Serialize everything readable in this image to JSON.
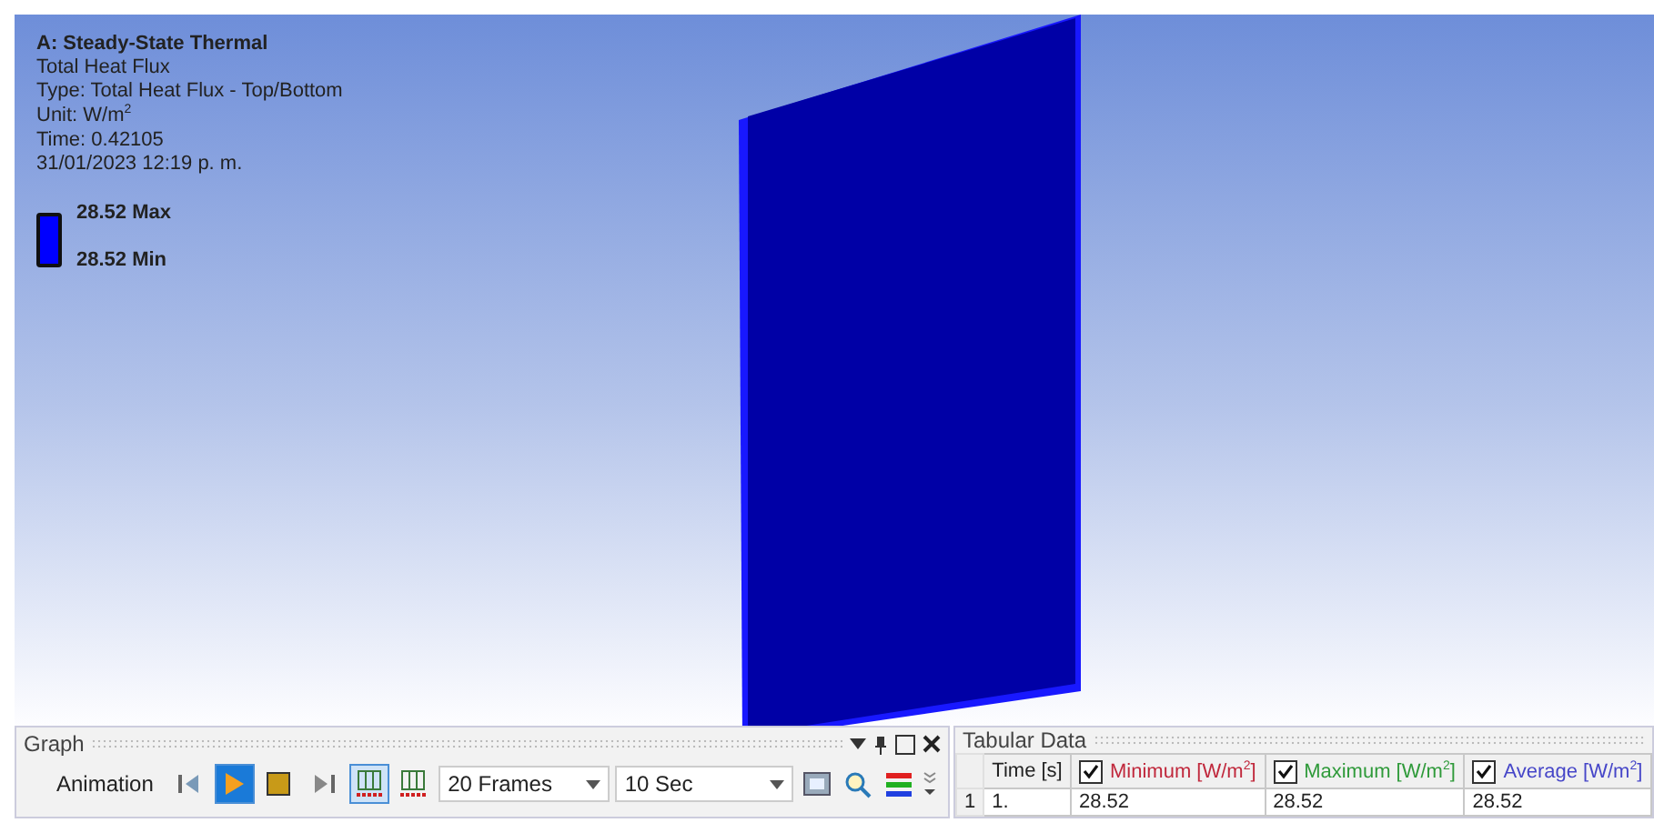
{
  "viewport": {
    "annotation": {
      "title": "A: Steady-State Thermal",
      "lines": [
        "Total Heat Flux",
        "Type: Total Heat Flux - Top/Bottom",
        "Unit: W/m$^{2}$",
        "Time: 0.42105",
        "31/01/2023 12:19 p. m."
      ]
    },
    "legend": {
      "max": "28.52 Max",
      "min": "28.52 Min"
    }
  },
  "graph_panel": {
    "title": "Graph",
    "toolbar": {
      "label": "Animation",
      "controls": [
        {
          "kind": "first",
          "selected": false
        },
        {
          "kind": "play",
          "selected": true
        },
        {
          "kind": "stop",
          "selected": false
        },
        {
          "kind": "last",
          "selected": false
        },
        {
          "kind": "mode",
          "selected": true
        },
        {
          "kind": "mode",
          "selected": false
        }
      ],
      "frames": "20 Frames",
      "duration": "10 Sec"
    }
  },
  "tabular_panel": {
    "title": "Tabular Data",
    "columns": [
      {
        "label": "Time [s]"
      },
      {
        "label": "Minimum [W/m$^{2}$]",
        "checked": true,
        "color": "#c0283c"
      },
      {
        "label": "Maximum [W/m$^{2}$]",
        "checked": true,
        "color": "#2f9a3a"
      },
      {
        "label": "Average [W/m$^{2}$]",
        "checked": true,
        "color": "#4646c8"
      }
    ],
    "rows": [
      {
        "index": "1",
        "cells": [
          "1.",
          "28.52",
          "28.52",
          "28.52"
        ]
      }
    ]
  }
}
